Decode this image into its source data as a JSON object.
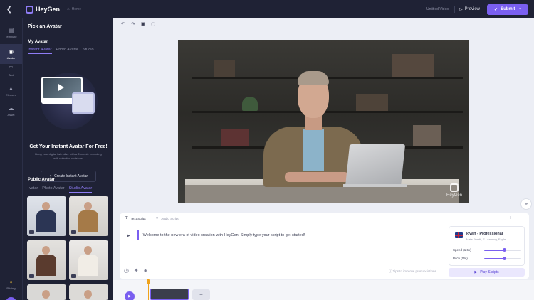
{
  "header": {
    "brand": "HeyGen",
    "breadcrumb": "Home",
    "video_title": "Untitled Video",
    "preview_label": "Preview",
    "submit_label": "Submit"
  },
  "rail": {
    "items": [
      {
        "label": "Template",
        "icon": "template-icon"
      },
      {
        "label": "Avatar",
        "icon": "avatar-icon"
      },
      {
        "label": "Text",
        "icon": "text-icon"
      },
      {
        "label": "Element",
        "icon": "element-icon"
      },
      {
        "label": "Asset",
        "icon": "asset-icon"
      }
    ],
    "pricing_label": "Pricing"
  },
  "panel": {
    "title": "Pick an Avatar",
    "my_avatar": {
      "title": "My Avatar",
      "tabs": [
        "Instant Avatar",
        "Photo Avatar",
        "Studio"
      ]
    },
    "promo": {
      "title": "Get Your Instant Avatar For Free!",
      "description": "Bring your digital twin alive with a 2-minute recording with unlimited revisions.",
      "button": "Create Instant Avatar"
    },
    "public_avatar": {
      "title": "Public Avatar",
      "tabs": [
        "vatar",
        "Photo Avatar",
        "Studio Avatar"
      ]
    }
  },
  "canvas": {
    "watermark": "HeyGen"
  },
  "script": {
    "tabs": [
      "Text Script",
      "Audio Script"
    ],
    "text_before": "Welcome to the new era of video creation with ",
    "text_link": "HeyGen",
    "text_after": "! Simply type your script to get started!",
    "hint": "Tips to improve pronunciations",
    "voice": {
      "name": "Ryan - Professional",
      "tags": "Male, Youth, E-Learning, Explai...",
      "speed_label": "Speed (1.0x)",
      "pitch_label": "Pitch (0%)",
      "speed_level": 0.55,
      "pitch_level": 0.55
    },
    "play_label": "Play Scripts"
  },
  "colors": {
    "accent": "#7a5ff0",
    "dark": "#1f2235",
    "marker": "#f0a31c"
  }
}
